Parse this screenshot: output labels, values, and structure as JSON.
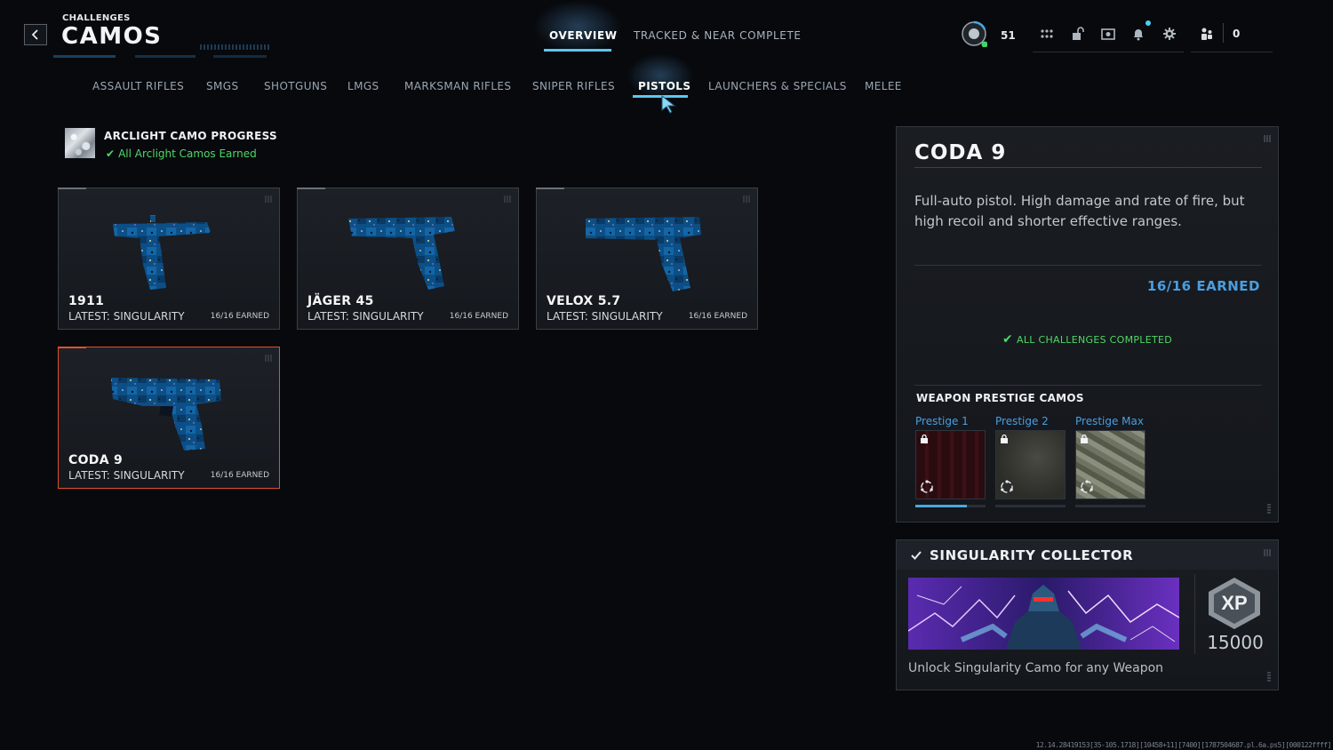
{
  "header": {
    "breadcrumb": "CHALLENGES",
    "title": "CAMOS",
    "tabs": [
      {
        "label": "OVERVIEW",
        "active": true
      },
      {
        "label": "TRACKED & NEAR COMPLETE",
        "active": false
      }
    ]
  },
  "hud": {
    "level": "51",
    "party_count": "0",
    "icons": [
      "level-emblem-icon",
      "apps-grid-icon",
      "unlock-icon",
      "store-icon",
      "notifications-icon",
      "settings-icon",
      "party-icon"
    ]
  },
  "categories": [
    {
      "label": "ASSAULT RIFLES",
      "active": false
    },
    {
      "label": "SMGS",
      "active": false
    },
    {
      "label": "SHOTGUNS",
      "active": false
    },
    {
      "label": "LMGS",
      "active": false
    },
    {
      "label": "MARKSMAN RIFLES",
      "active": false
    },
    {
      "label": "SNIPER RIFLES",
      "active": false
    },
    {
      "label": "PISTOLS",
      "active": true
    },
    {
      "label": "LAUNCHERS & SPECIALS",
      "active": false
    },
    {
      "label": "MELEE",
      "active": false
    }
  ],
  "arclight": {
    "title": "ARCLIGHT CAMO PROGRESS",
    "status": "All Arclight Camos Earned"
  },
  "weapons": [
    {
      "name": "1911",
      "latest": "LATEST: SINGULARITY",
      "earned": "16/16 EARNED",
      "selected": false
    },
    {
      "name": "JÄGER 45",
      "latest": "LATEST: SINGULARITY",
      "earned": "16/16 EARNED",
      "selected": false
    },
    {
      "name": "VELOX 5.7",
      "latest": "LATEST: SINGULARITY",
      "earned": "16/16 EARNED",
      "selected": false
    },
    {
      "name": "CODA 9",
      "latest": "LATEST: SINGULARITY",
      "earned": "16/16 EARNED",
      "selected": true
    }
  ],
  "detail": {
    "name": "CODA 9",
    "description": "Full-auto pistol. High damage and rate of fire, but high recoil and shorter effective ranges.",
    "earned": "16/16 EARNED",
    "status": "ALL CHALLENGES COMPLETED",
    "prestige_heading": "WEAPON PRESTIGE CAMOS",
    "prestige": [
      {
        "label": "Prestige 1",
        "locked": true,
        "progress": 0.74
      },
      {
        "label": "Prestige 2",
        "locked": true,
        "progress": 0
      },
      {
        "label": "Prestige Max",
        "locked": true,
        "progress": 0
      }
    ]
  },
  "collector": {
    "title": "SINGULARITY COLLECTOR",
    "xp_label": "XP",
    "xp_value": "15000",
    "description": "Unlock Singularity Camo for any Weapon"
  },
  "build_string": "12.14.28419153[35-105.1718][10458+11][7400][1787504687.pl.6a.ps5][000122ffff]",
  "colors": {
    "accent_blue": "#4a9ee0",
    "success_green": "#4fd866",
    "selected_orange": "#e0502e",
    "tab_underline": "#5ac8f0"
  }
}
